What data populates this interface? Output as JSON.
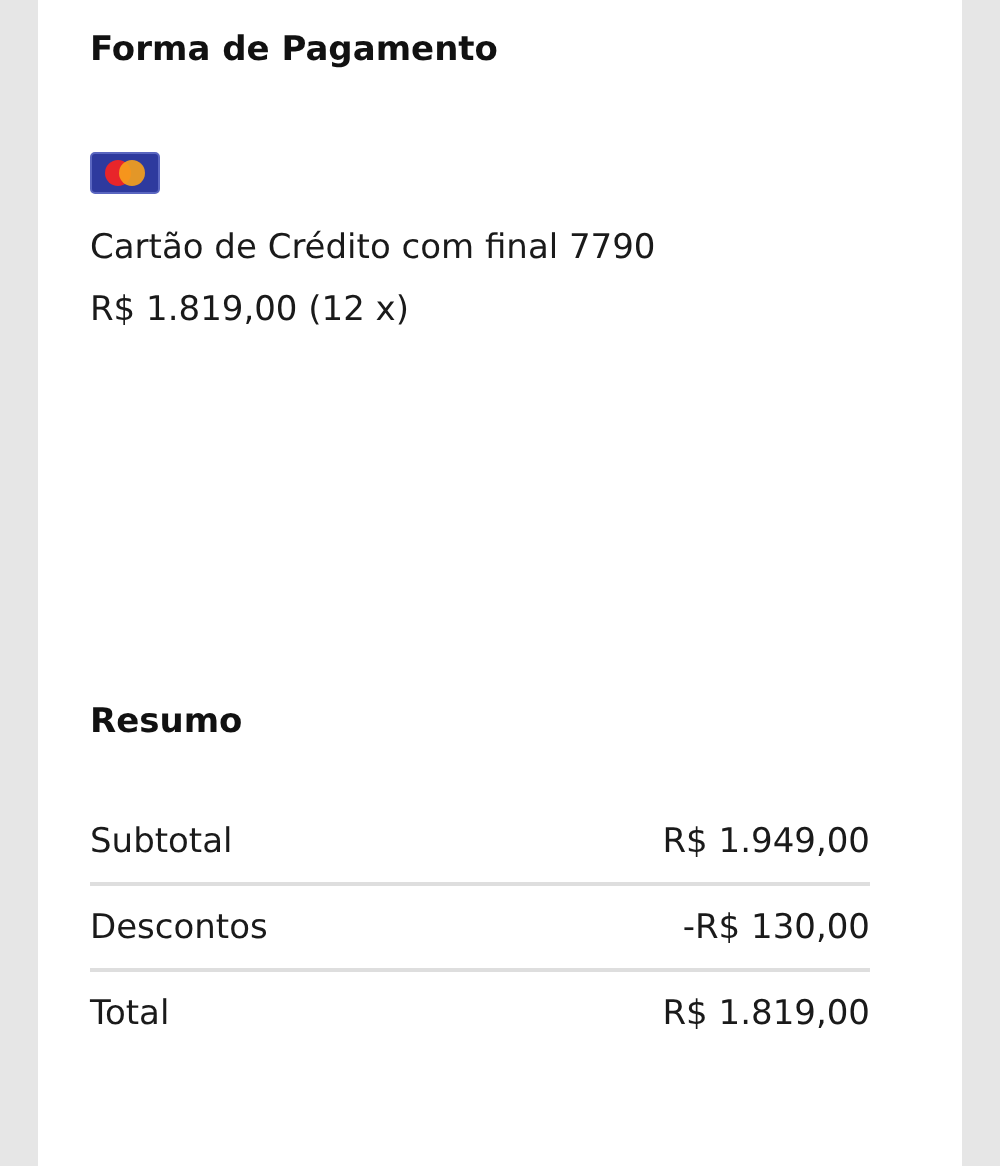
{
  "payment": {
    "title": "Forma de Pagamento",
    "card_description": "Cartão de Crédito com final 7790",
    "amount": "R$ 1.819,00 (12 x)"
  },
  "summary": {
    "title": "Resumo",
    "rows": [
      {
        "label": "Subtotal",
        "value": "R$ 1.949,00"
      },
      {
        "label": "Descontos",
        "value": "-R$ 130,00"
      },
      {
        "label": "Total",
        "value": "R$ 1.819,00"
      }
    ]
  }
}
